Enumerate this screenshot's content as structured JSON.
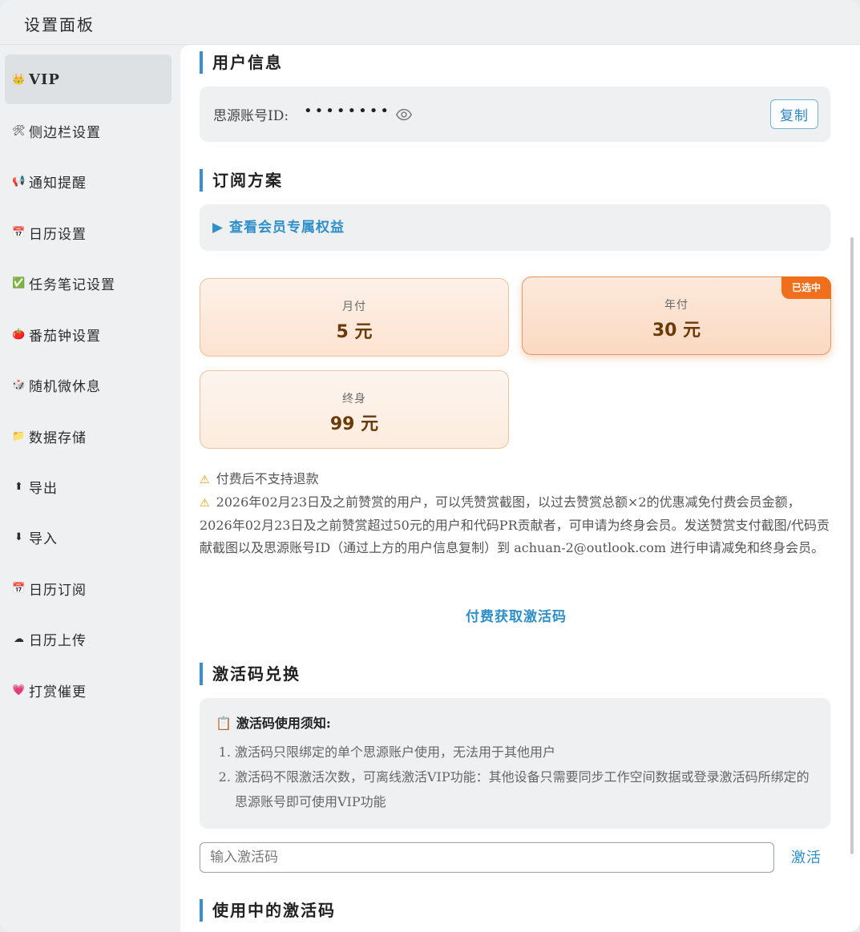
{
  "window": {
    "title": "设置面板"
  },
  "sidebar": {
    "items": [
      {
        "icon": "👑",
        "label": "VIP"
      },
      {
        "icon": "🛠",
        "label": "侧边栏设置"
      },
      {
        "icon": "📢",
        "label": "通知提醒"
      },
      {
        "icon": "📅",
        "label": "日历设置"
      },
      {
        "icon": "✅",
        "label": "任务笔记设置"
      },
      {
        "icon": "🍅",
        "label": "番茄钟设置"
      },
      {
        "icon": "🎲",
        "label": "随机微休息"
      },
      {
        "icon": "📁",
        "label": "数据存储"
      },
      {
        "icon": "⬆",
        "label": "导出"
      },
      {
        "icon": "⬇",
        "label": "导入"
      },
      {
        "icon": "📅",
        "label": "日历订阅"
      },
      {
        "icon": "☁",
        "label": "日历上传"
      },
      {
        "icon": "💗",
        "label": "打赏催更"
      }
    ]
  },
  "user_info": {
    "title": "用户信息",
    "label": "思源账号ID:",
    "masked_value": "••••••••",
    "copy_label": "复制"
  },
  "subscription": {
    "title": "订阅方案",
    "benefits_label": "▶ 查看会员专属权益",
    "plans": [
      {
        "name": "月付",
        "price": "5 元"
      },
      {
        "name": "年付",
        "price": "30 元",
        "badge": "已选中"
      },
      {
        "name": "终身",
        "price": "99 元"
      }
    ],
    "notes": [
      "付费后不支持退款",
      "2026年02月23日及之前赞赏的用户，可以凭赞赏截图，以过去赞赏总额×2的优惠减免付费会员金额，2026年02月23日及之前赞赏超过50元的用户和代码PR贡献者，可申请为终身会员。发送赞赏支付截图/代码贡献截图以及思源账号ID（通过上方的用户信息复制）到 achuan-2@outlook.com 进行申请减免和终身会员。"
    ],
    "pay_link": "付费获取激活码"
  },
  "activation": {
    "title": "激活码兑换",
    "notice_title": "激活码使用须知:",
    "notice_items": [
      "激活码只限绑定的单个思源账户使用，无法用于其他用户",
      "激活码不限激活次数，可离线激活VIP功能：其他设备只需要同步工作空间数据或登录激活码所绑定的思源账号即可使用VIP功能"
    ],
    "input_placeholder": "输入激活码",
    "activate_label": "激活"
  },
  "active_codes": {
    "title": "使用中的激活码"
  },
  "colors": {
    "accent": "#2f8fc8",
    "badge": "#f06e1c",
    "plan_border": "#efc29c"
  }
}
